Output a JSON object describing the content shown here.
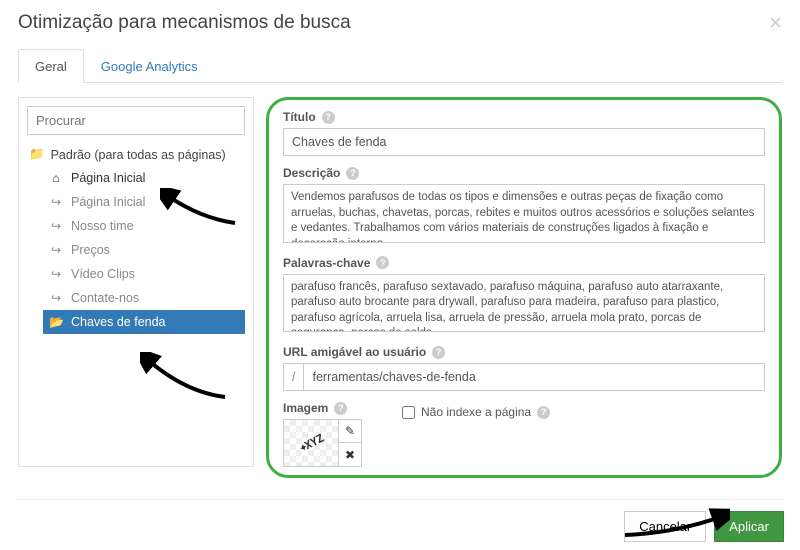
{
  "header": {
    "title": "Otimização para mecanismos de busca"
  },
  "tabs": {
    "general": "Geral",
    "analytics": "Google Analytics"
  },
  "sidebar": {
    "search_placeholder": "Procurar",
    "root_label": "Padrão (para todas as páginas)",
    "items": [
      {
        "label": "Página Inicial",
        "icon": "home",
        "strong": true
      },
      {
        "label": "Página Inicial",
        "icon": "share"
      },
      {
        "label": "Nosso time",
        "icon": "share"
      },
      {
        "label": "Preços",
        "icon": "share"
      },
      {
        "label": "Vídeo Clips",
        "icon": "share"
      },
      {
        "label": "Contate-nos",
        "icon": "share"
      },
      {
        "label": "Chaves de fenda",
        "icon": "folder",
        "active": true
      }
    ]
  },
  "form": {
    "title_label": "Título",
    "title_value": "Chaves de fenda",
    "desc_label": "Descrição",
    "desc_value": "Vendemos parafusos de todas os tipos e dimensões e outras peças de fixação como arruelas, buchas, chavetas, porcas, rebites e muitos outros acessórios e soluções selantes e vedantes. Trabalhamos com vários materiais de construções ligados à fixação e decoração interna.",
    "keywords_label": "Palavras-chave",
    "keywords_value": "parafuso francês, parafuso sextavado, parafuso máquina, parafuso auto atarraxante, parafuso auto brocante para drywall, parafuso para madeira, parafuso para plastico, parafuso agrícola, arruela lisa, arruela de pressão, arruela mola prato, porcas de segurança, porcas de solda",
    "url_label": "URL amigável ao usuário",
    "url_prefix": "/",
    "url_value": "ferramentas/chaves-de-fenda",
    "image_label": "Imagem",
    "thumb_text": "XYZ",
    "noindex_label": "Não indexe a página"
  },
  "footer": {
    "cancel": "Cancelar",
    "apply": "Aplicar"
  }
}
